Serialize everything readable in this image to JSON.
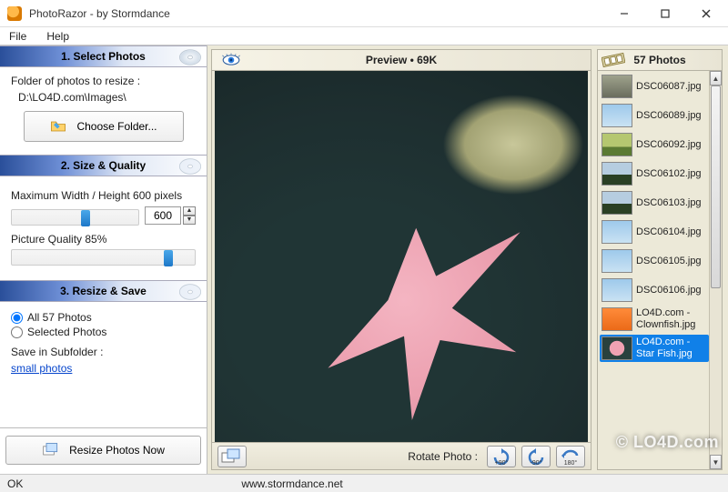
{
  "titlebar": {
    "title": "PhotoRazor - by Stormdance"
  },
  "menu": {
    "file": "File",
    "help": "Help"
  },
  "sidebar": {
    "section1": {
      "heading": "1. Select Photos",
      "folder_label": "Folder of photos to resize :",
      "folder_path": "D:\\LO4D.com\\Images\\",
      "choose_button": "Choose Folder..."
    },
    "section2": {
      "heading": "2. Size & Quality",
      "max_label": "Maximum Width / Height 600 pixels",
      "max_value": "600",
      "quality_label": "Picture Quality 85%"
    },
    "section3": {
      "heading": "3. Resize & Save",
      "radio_all": "All 57 Photos",
      "radio_selected": "Selected Photos",
      "subfolder_label": "Save in Subfolder :",
      "subfolder_value": "small photos",
      "resize_button": "Resize Photos Now"
    }
  },
  "preview": {
    "header_text": "Preview • 69K",
    "rotate_label": "Rotate Photo :",
    "rot_p90": "+90°",
    "rot_m90": "-90°",
    "rot_180": "180°"
  },
  "right": {
    "header": "57 Photos",
    "thumbs": [
      {
        "label": "DSC06087.jpg",
        "cls": "rock"
      },
      {
        "label": "DSC06089.jpg",
        "cls": "sky"
      },
      {
        "label": "DSC06092.jpg",
        "cls": "grass"
      },
      {
        "label": "DSC06102.jpg",
        "cls": "tree"
      },
      {
        "label": "DSC06103.jpg",
        "cls": "tree"
      },
      {
        "label": "DSC06104.jpg",
        "cls": "sky"
      },
      {
        "label": "DSC06105.jpg",
        "cls": "sky"
      },
      {
        "label": "DSC06106.jpg",
        "cls": "sky"
      },
      {
        "label": "LO4D.com - Clownfish.jpg",
        "cls": "clown"
      },
      {
        "label": "LO4D.com - Star Fish.jpg",
        "cls": "star",
        "selected": true
      }
    ]
  },
  "status": {
    "left": "OK",
    "site": "www.stormdance.net"
  },
  "watermark": "© LO4D.com"
}
